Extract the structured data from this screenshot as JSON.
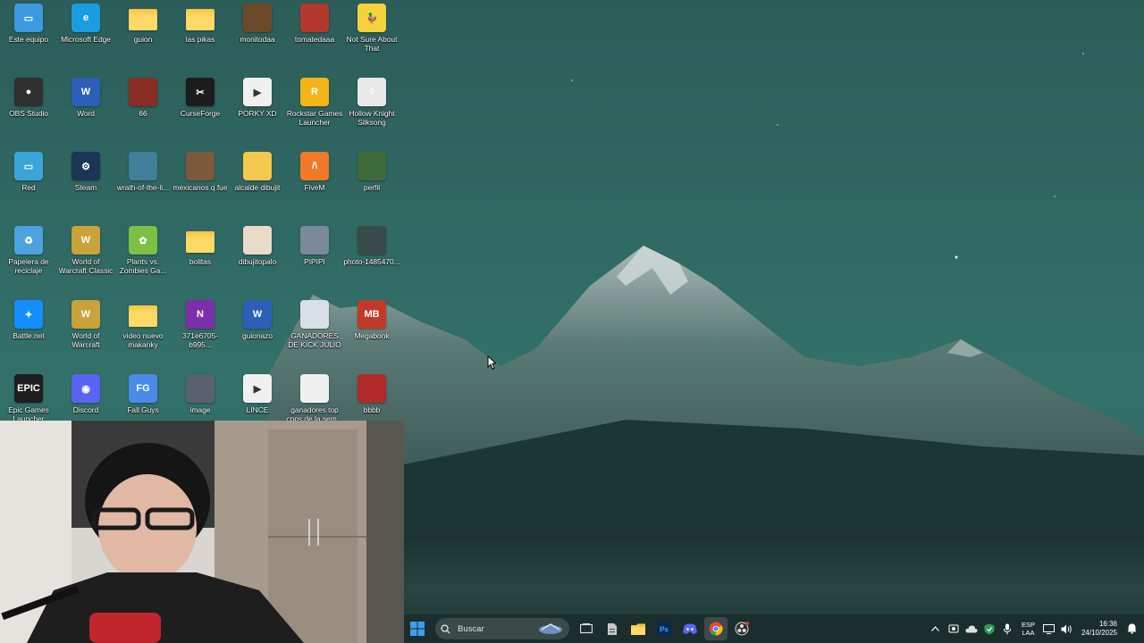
{
  "desktop_icons": [
    {
      "label": "Este equipo",
      "icon": "monitor-icon",
      "color": "#3b9ae0"
    },
    {
      "label": "Microsoft Edge",
      "icon": "edge-icon",
      "color": "#1a9de0"
    },
    {
      "label": "guion",
      "icon": "folder-icon",
      "color": "#f4c542"
    },
    {
      "label": "las pikas",
      "icon": "folder-icon",
      "color": "#f4c542"
    },
    {
      "label": "monitodaa",
      "icon": "image-thumbnail-icon",
      "color": "#6b4a2a"
    },
    {
      "label": "tomatedaaa",
      "icon": "image-thumbnail-icon",
      "color": "#b3392e"
    },
    {
      "label": "Not Sure About That",
      "icon": "duck-icon",
      "color": "#f4d23a"
    },
    {
      "label": "OBS Studio",
      "icon": "obs-icon",
      "color": "#303030"
    },
    {
      "label": "Word",
      "icon": "word-icon",
      "color": "#2b5fb8"
    },
    {
      "label": "66",
      "icon": "image-thumbnail-icon",
      "color": "#8a2d24"
    },
    {
      "label": "CurseForge",
      "icon": "curseforge-icon",
      "color": "#1d1d1d"
    },
    {
      "label": "PORKY XD",
      "icon": "video-file-icon",
      "color": "#f0f0f0"
    },
    {
      "label": "Rockstar Games Launcher",
      "icon": "rockstar-icon",
      "color": "#f2b418"
    },
    {
      "label": "Hollow Knight Silksong",
      "icon": "hollow-knight-icon",
      "color": "#e8e8e8"
    },
    {
      "label": "Red",
      "icon": "network-icon",
      "color": "#3aa6d8"
    },
    {
      "label": "Steam",
      "icon": "steam-icon",
      "color": "#1b3556"
    },
    {
      "label": "wrath-of-the-li...",
      "icon": "image-thumbnail-icon",
      "color": "#3f7f9a"
    },
    {
      "label": "mexicanos q fue",
      "icon": "image-thumbnail-icon",
      "color": "#7a5a3a"
    },
    {
      "label": "alcalde dibujit",
      "icon": "image-thumbnail-icon",
      "color": "#f2c94c"
    },
    {
      "label": "FiveM",
      "icon": "fivem-icon",
      "color": "#f07a2a"
    },
    {
      "label": "perfil",
      "icon": "image-thumbnail-icon",
      "color": "#3f6b3a"
    },
    {
      "label": "Papelera de reciclaje",
      "icon": "recycle-bin-icon",
      "color": "#4aa3df"
    },
    {
      "label": "World of Warcraft Classic",
      "icon": "wow-icon",
      "color": "#c9a23a"
    },
    {
      "label": "Plants vs. Zombies Ga...",
      "icon": "pvz-icon",
      "color": "#7bbf45"
    },
    {
      "label": "bolitas",
      "icon": "folder-icon",
      "color": "#f4c542"
    },
    {
      "label": "dibujitopalo",
      "icon": "image-thumbnail-icon",
      "color": "#e8dcc8"
    },
    {
      "label": "PIPIPI",
      "icon": "image-thumbnail-icon",
      "color": "#7a8a9a"
    },
    {
      "label": "photo-1485470...",
      "icon": "image-thumbnail-icon",
      "color": "#3a4a4a"
    },
    {
      "label": "Battle.net",
      "icon": "battlenet-icon",
      "color": "#148eff"
    },
    {
      "label": "World of Warcraft",
      "icon": "wow-icon",
      "color": "#c9a23a"
    },
    {
      "label": "video nuevo makanky",
      "icon": "folder-icon",
      "color": "#f4c542"
    },
    {
      "label": "371e6705-b995...",
      "icon": "onenote-icon",
      "color": "#7b2fa8"
    },
    {
      "label": "guionazo",
      "icon": "word-doc-icon",
      "color": "#2b5fb8"
    },
    {
      "label": "GANADORES DE KICK JULIO",
      "icon": "image-thumbnail-icon",
      "color": "#d8dfe8"
    },
    {
      "label": "Megabonk",
      "icon": "megabonk-icon",
      "color": "#c03a2a"
    },
    {
      "label": "Epic Games Launcher",
      "icon": "epic-games-icon",
      "color": "#1e1e1e"
    },
    {
      "label": "Discord",
      "icon": "discord-icon",
      "color": "#5865f2"
    },
    {
      "label": "Fall Guys",
      "icon": "fall-guys-icon",
      "color": "#4a8ae8"
    },
    {
      "label": "image",
      "icon": "image-thumbnail-icon",
      "color": "#5a6070"
    },
    {
      "label": "LINCE",
      "icon": "video-file-icon",
      "color": "#f0f0f0"
    },
    {
      "label": "ganadores top cpps de la sem...",
      "icon": "image-thumbnail-icon",
      "color": "#f0f0f0"
    },
    {
      "label": "bbbb",
      "icon": "image-thumbnail-icon",
      "color": "#b02a2a"
    }
  ],
  "taskbar": {
    "search_placeholder": "Buscar",
    "apps": [
      {
        "name": "start-button",
        "icon": "windows-logo-icon",
        "color": "#3aa0f0"
      },
      {
        "name": "task-view-button",
        "icon": "task-view-icon",
        "color": "#dcdcdc"
      },
      {
        "name": "taskbar-app-file",
        "icon": "file-icon",
        "color": "#c8c8c8"
      },
      {
        "name": "taskbar-app-explorer",
        "icon": "folder-icon",
        "color": "#f4c542"
      },
      {
        "name": "taskbar-app-photoshop",
        "icon": "photoshop-icon",
        "color": "#0a2a52"
      },
      {
        "name": "taskbar-app-discord",
        "icon": "discord-icon",
        "color": "#5865f2"
      },
      {
        "name": "taskbar-app-chrome",
        "icon": "chrome-icon",
        "color": "#e8453c"
      },
      {
        "name": "taskbar-app-obs",
        "icon": "obs-icon",
        "color": "#303030"
      }
    ],
    "tray": {
      "language": "ESP",
      "layout": "LAA",
      "time": "16:36",
      "date": "24/10/2025"
    }
  }
}
